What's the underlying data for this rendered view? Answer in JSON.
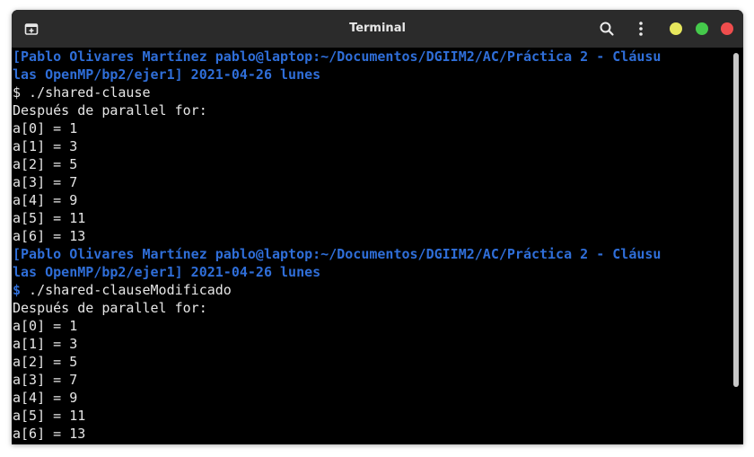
{
  "window": {
    "title": "Terminal"
  },
  "icons": {
    "new_tab": "new-tab-icon",
    "search": "search-icon",
    "menu": "kebab-menu-icon",
    "minimize": "minimize-dot",
    "maximize": "maximize-dot",
    "close": "close-dot"
  },
  "colors": {
    "prompt_blue": "#2f6ed8",
    "terminal_bg": "#000000",
    "text": "#e6e6e6",
    "titlebar_bg": "#2b2b2b",
    "min": "#e7e75d",
    "max": "#45c94b",
    "close": "#ef4d4d"
  },
  "terminal": {
    "lines": [
      {
        "type": "prompt",
        "text": "[Pablo Olivares Martínez pablo@laptop:~/Documentos/DGIIM2/AC/Práctica 2 - Cláusu"
      },
      {
        "type": "prompt",
        "text": "las OpenMP/bp2/ejer1] 2021-04-26 lunes"
      },
      {
        "type": "cmd",
        "dollar": "$",
        "text": " ./shared-clause"
      },
      {
        "type": "out",
        "text": "Después de parallel for:"
      },
      {
        "type": "out",
        "text": "a[0] = 1"
      },
      {
        "type": "out",
        "text": "a[1] = 3"
      },
      {
        "type": "out",
        "text": "a[2] = 5"
      },
      {
        "type": "out",
        "text": "a[3] = 7"
      },
      {
        "type": "out",
        "text": "a[4] = 9"
      },
      {
        "type": "out",
        "text": "a[5] = 11"
      },
      {
        "type": "out",
        "text": "a[6] = 13"
      },
      {
        "type": "prompt",
        "text": "[Pablo Olivares Martínez pablo@laptop:~/Documentos/DGIIM2/AC/Práctica 2 - Cláusu"
      },
      {
        "type": "prompt",
        "text": "las OpenMP/bp2/ejer1] 2021-04-26 lunes"
      },
      {
        "type": "cmd2",
        "dollar": "$",
        "text": " ./shared-clauseModificado"
      },
      {
        "type": "out",
        "text": "Después de parallel for:"
      },
      {
        "type": "out",
        "text": "a[0] = 1"
      },
      {
        "type": "out",
        "text": "a[1] = 3"
      },
      {
        "type": "out",
        "text": "a[2] = 5"
      },
      {
        "type": "out",
        "text": "a[3] = 7"
      },
      {
        "type": "out",
        "text": "a[4] = 9"
      },
      {
        "type": "out",
        "text": "a[5] = 11"
      },
      {
        "type": "out",
        "text": "a[6] = 13"
      }
    ]
  }
}
